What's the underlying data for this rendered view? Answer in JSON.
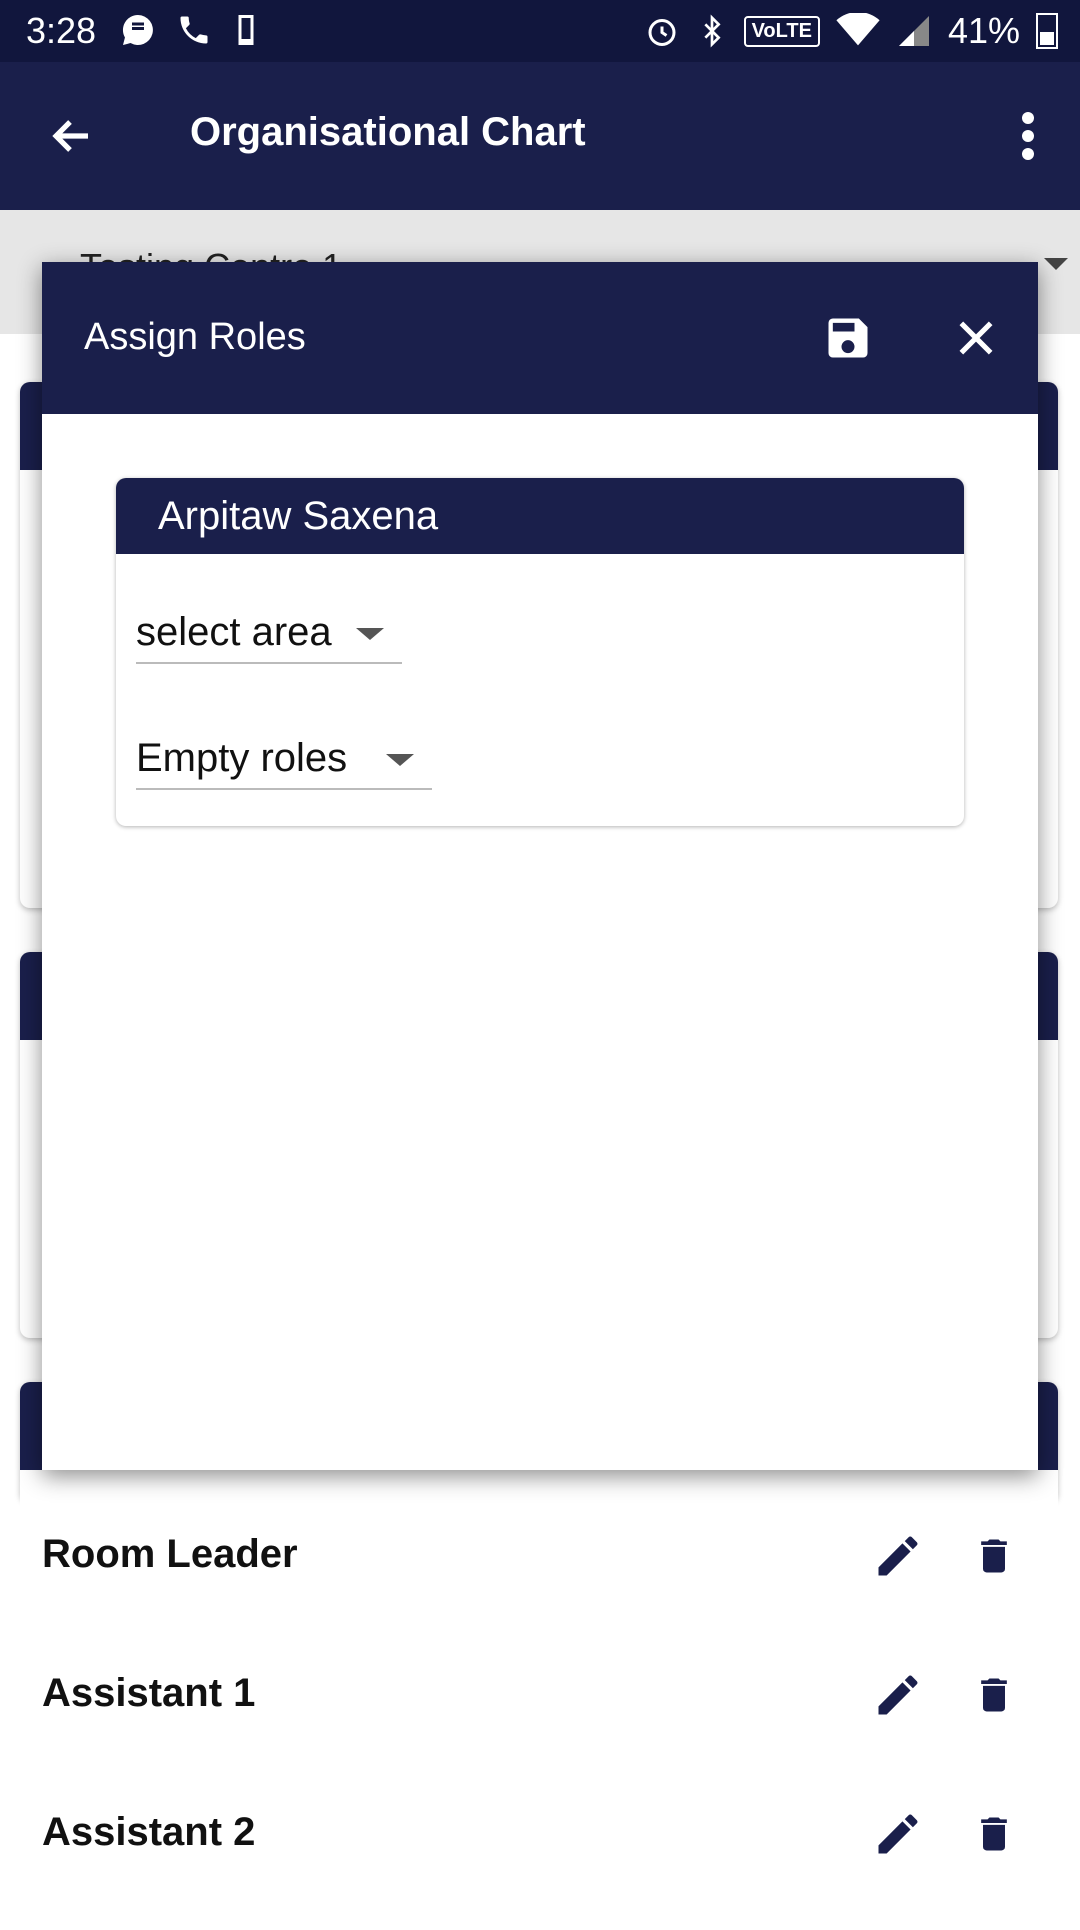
{
  "status_bar": {
    "time": "3:28",
    "network_label": "VoLTE",
    "battery": "41%"
  },
  "app_bar": {
    "title": "Organisational Chart",
    "back_icon": "arrow-left-icon",
    "menu_icon": "more-vert-icon"
  },
  "subheader": {
    "partial_text": "Testing Centre 1"
  },
  "dialog": {
    "title": "Assign Roles",
    "save_icon": "save-icon",
    "close_icon": "close-icon",
    "person": {
      "name": "Arpitaw  Saxena",
      "area_select": "select area",
      "roles_select": "Empty roles"
    }
  },
  "roles": [
    {
      "name": "Room Leader"
    },
    {
      "name": "Assistant 1"
    },
    {
      "name": "Assistant 2"
    }
  ],
  "colors": {
    "primary": "#1a1f4b",
    "status_bar": "#11163d"
  }
}
